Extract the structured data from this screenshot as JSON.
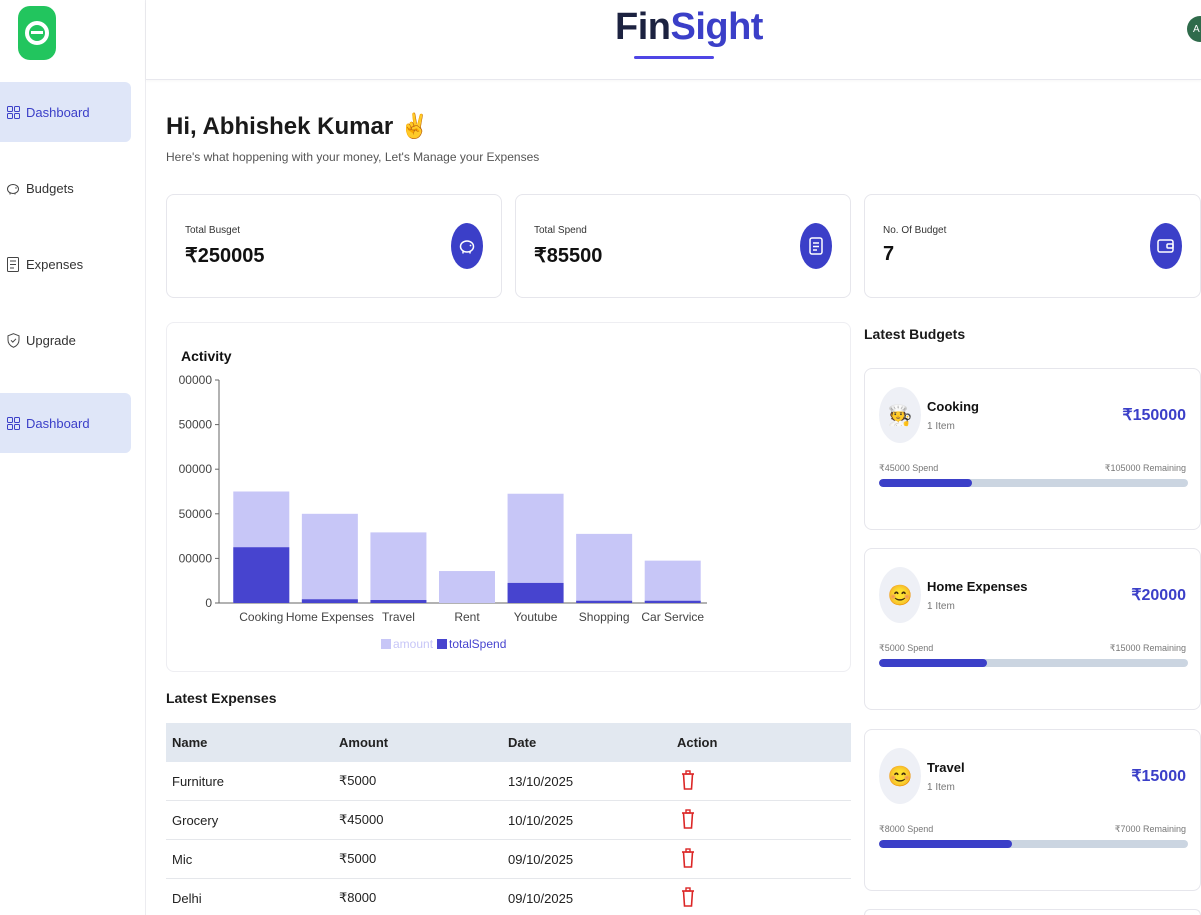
{
  "brand": {
    "part1": "Fin",
    "part2": "Sight"
  },
  "avatar": {
    "initial": "A"
  },
  "sidebar": {
    "items": [
      {
        "label": "Dashboard",
        "icon": "grid-icon",
        "active": true
      },
      {
        "label": "Budgets",
        "icon": "piggy-bank-icon",
        "active": false
      },
      {
        "label": "Expenses",
        "icon": "receipt-icon",
        "active": false
      },
      {
        "label": "Upgrade",
        "icon": "shield-check-icon",
        "active": false
      },
      {
        "label": "Dashboard",
        "icon": "grid-icon",
        "active": true
      }
    ]
  },
  "greeting": {
    "title": "Hi, Abhishek Kumar ✌️",
    "subtitle": "Here's what hoppening with your money, Let's Manage your Expenses"
  },
  "stats": [
    {
      "label": "Total Busget",
      "value": "₹250005",
      "icon": "piggy-bank-icon"
    },
    {
      "label": "Total Spend",
      "value": "₹85500",
      "icon": "receipt-icon"
    },
    {
      "label": "No. Of Budget",
      "value": "7",
      "icon": "wallet-icon"
    }
  ],
  "activity": {
    "title": "Activity"
  },
  "chart_data": {
    "type": "bar",
    "categories": [
      "Cooking",
      "Home Expenses",
      "Travel",
      "Rent",
      "Youtube",
      "Shopping",
      "Car Service"
    ],
    "series": [
      {
        "name": "amount",
        "values": [
          150000,
          120000,
          95000,
          43000,
          147000,
          93000,
          57000
        ],
        "color": "#c7c6f7"
      },
      {
        "name": "totalSpend",
        "values": [
          75000,
          5000,
          4000,
          0,
          27000,
          3000,
          3000
        ],
        "color": "#4744cf"
      }
    ],
    "ytick_labels": [
      "0",
      "00000",
      "50000",
      "00000",
      "50000",
      "00000"
    ],
    "ylim": [
      0,
      300000
    ],
    "legend": "bottom",
    "stacked": false
  },
  "latest_expenses": {
    "title": "Latest Expenses",
    "columns": [
      "Name",
      "Amount",
      "Date",
      "Action"
    ],
    "rows": [
      {
        "name": "Furniture",
        "amount": "₹5000",
        "date": "13/10/2025"
      },
      {
        "name": "Grocery",
        "amount": "₹45000",
        "date": "10/10/2025"
      },
      {
        "name": "Mic",
        "amount": "₹5000",
        "date": "09/10/2025"
      },
      {
        "name": "Delhi",
        "amount": "₹8000",
        "date": "09/10/2025"
      }
    ]
  },
  "latest_budgets": {
    "title": "Latest Budgets",
    "items": [
      {
        "emoji": "🧑‍🍳",
        "name": "Cooking",
        "items": "1 Item",
        "amount": "₹150000",
        "spend": "₹45000 Spend",
        "remaining": "₹105000 Remaining",
        "progress": 0.3
      },
      {
        "emoji": "😊",
        "name": "Home Expenses",
        "items": "1 Item",
        "amount": "₹20000",
        "spend": "₹5000 Spend",
        "remaining": "₹15000 Remaining",
        "progress": 0.35
      },
      {
        "emoji": "😊",
        "name": "Travel",
        "items": "1 Item",
        "amount": "₹15000",
        "spend": "₹8000 Spend",
        "remaining": "₹7000 Remaining",
        "progress": 0.43
      }
    ]
  },
  "colors": {
    "accent": "#3b3fc8",
    "brand_green": "#22c55e",
    "danger": "#dc2626"
  }
}
